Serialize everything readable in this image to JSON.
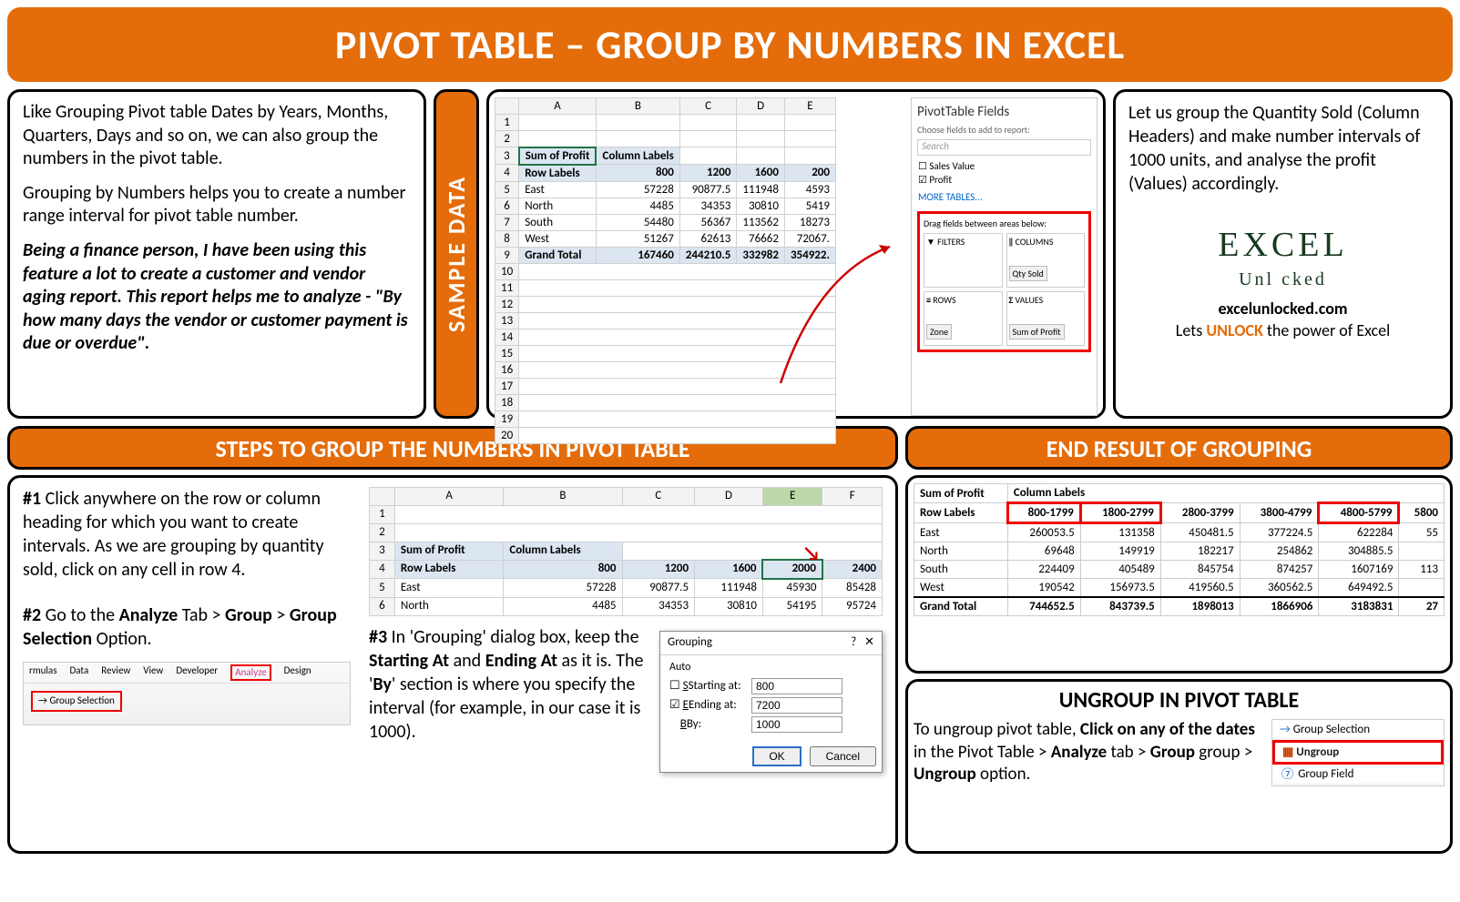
{
  "title": "PIVOT TABLE – GROUP BY NUMBERS IN EXCEL",
  "intro": {
    "p1": "Like Grouping Pivot table Dates by Years, Months, Quarters, Days and so on, we can also group the numbers in the pivot table.",
    "p2": "Grouping by Numbers helps you to create a number range interval for pivot table number.",
    "p3": "Being a finance person, I have been using this feature a lot to create a customer and vendor aging report. This report helps me to analyze - \"By how many days the vendor or customer payment is due or overdue\"."
  },
  "sample_label": "SAMPLE DATA",
  "sample": {
    "cols": [
      "",
      "A",
      "B",
      "C",
      "D",
      "E"
    ],
    "header_label": "Sum of Profit",
    "col_label": "Column Labels",
    "row_label": "Row Labels",
    "col_vals": [
      "800",
      "1200",
      "1600",
      "200"
    ],
    "rows": [
      {
        "n": "5",
        "lbl": "East",
        "v": [
          "57228",
          "90877.5",
          "111948",
          "4593"
        ]
      },
      {
        "n": "6",
        "lbl": "North",
        "v": [
          "4485",
          "34353",
          "30810",
          "5419"
        ]
      },
      {
        "n": "7",
        "lbl": "South",
        "v": [
          "54480",
          "56367",
          "113562",
          "18273"
        ]
      },
      {
        "n": "8",
        "lbl": "West",
        "v": [
          "51267",
          "62613",
          "76662",
          "72067."
        ]
      },
      {
        "n": "9",
        "lbl": "Grand Total",
        "v": [
          "167460",
          "244210.5",
          "332982",
          "354922."
        ]
      }
    ]
  },
  "pt_fields": {
    "title": "PivotTable Fields",
    "sub": "Choose fields to add to report:",
    "search": "Search",
    "f1": "Sales Value",
    "f2": "Profit",
    "more": "MORE TABLES...",
    "drag": "Drag fields between areas below:",
    "filters": "FILTERS",
    "columns": "COLUMNS",
    "rows": "ROWS",
    "values": "VALUES",
    "col_tag": "Qty Sold",
    "row_tag": "Zone",
    "val_tag": "Sum of Profit"
  },
  "right_note": "Let us group the Quantity Sold (Column Headers) and make number intervals of 1000 units, and analyse the profit (Values) accordingly.",
  "brand": {
    "logo1": "EXCEL",
    "logo2": "Unl   cked",
    "site": "excelunlocked.com",
    "tag_pre": "Lets ",
    "tag_bold": "UNLOCK",
    "tag_post": " the power of Excel"
  },
  "heads": {
    "steps": "STEPS TO GROUP THE NUMBERS IN PIVOT TABLE",
    "end": "END RESULT OF GROUPING"
  },
  "steps": {
    "s1_pre": "#1",
    "s1": " Click anywhere on the row or column heading for which you want to create intervals. As we are grouping by quantity sold, click on any cell in row 4.",
    "s2_pre": "#2",
    "s2a": " Go to the ",
    "s2b": "Analyze",
    "s2c": " Tab > ",
    "s2d": "Group",
    "s2e": " > ",
    "s2f": "Group Selection",
    "s2g": " Option.",
    "s3_pre": "#3",
    "s3a": " In 'Grouping' dialog box, keep the ",
    "s3b": "Starting At",
    "s3c": " and ",
    "s3d": "Ending At",
    "s3e": " as it is. The '",
    "s3f": "By",
    "s3g": "' section is where you specify the interval (for example, in our case it is 1000)."
  },
  "ribbon": {
    "tabs": [
      "rmulas",
      "Data",
      "Review",
      "View",
      "Developer",
      "Analyze",
      "Design"
    ],
    "btn": "Group Selection"
  },
  "mini2": {
    "cols": [
      "",
      "A",
      "B",
      "C",
      "D",
      "E",
      "F"
    ],
    "header_label": "Sum of Profit",
    "col_label": "Column Labels",
    "row_label": "Row Labels",
    "col_vals": [
      "800",
      "1200",
      "1600",
      "2000",
      "2400"
    ],
    "rows": [
      {
        "n": "5",
        "lbl": "East",
        "v": [
          "57228",
          "90877.5",
          "111948",
          "45930",
          "85428"
        ]
      },
      {
        "n": "6",
        "lbl": "North",
        "v": [
          "4485",
          "34353",
          "30810",
          "54195",
          "95724"
        ]
      }
    ]
  },
  "dlg": {
    "title": "Grouping",
    "auto": "Auto",
    "start_lbl": "Starting at:",
    "start_val": "800",
    "end_lbl": "Ending at:",
    "end_val": "7200",
    "by_lbl": "By:",
    "by_val": "1000",
    "ok": "OK",
    "cancel": "Cancel"
  },
  "result": {
    "h1": "Sum of Profit",
    "h2": "Column Labels",
    "row_lbl": "Row Labels",
    "ranges": [
      "800-1799",
      "1800-2799",
      "2800-3799",
      "3800-4799",
      "4800-5799",
      "5800"
    ],
    "rows": [
      {
        "lbl": "East",
        "v": [
          "260053.5",
          "131358",
          "450481.5",
          "377224.5",
          "622284",
          "55"
        ]
      },
      {
        "lbl": "North",
        "v": [
          "69648",
          "149919",
          "182217",
          "254862",
          "304885.5",
          ""
        ]
      },
      {
        "lbl": "South",
        "v": [
          "224409",
          "405489",
          "845754",
          "874257",
          "1607169",
          "113"
        ]
      },
      {
        "lbl": "West",
        "v": [
          "190542",
          "156973.5",
          "419560.5",
          "360562.5",
          "649492.5",
          ""
        ]
      },
      {
        "lbl": "Grand Total",
        "v": [
          "744652.5",
          "843739.5",
          "1898013",
          "1866906",
          "3183831",
          "27"
        ]
      }
    ]
  },
  "ungroup": {
    "head": "UNGROUP IN PIVOT TABLE",
    "t1": "To ungroup pivot table, ",
    "t2": "Click on any of the dates",
    "t3": " in the Pivot Table > ",
    "t4": "Analyze",
    "t5": " tab > ",
    "t6": "Group",
    "t7": " group > ",
    "t8": "Ungroup",
    "t9": " option.",
    "menu": [
      "Group Selection",
      "Ungroup",
      "Group Field"
    ]
  }
}
